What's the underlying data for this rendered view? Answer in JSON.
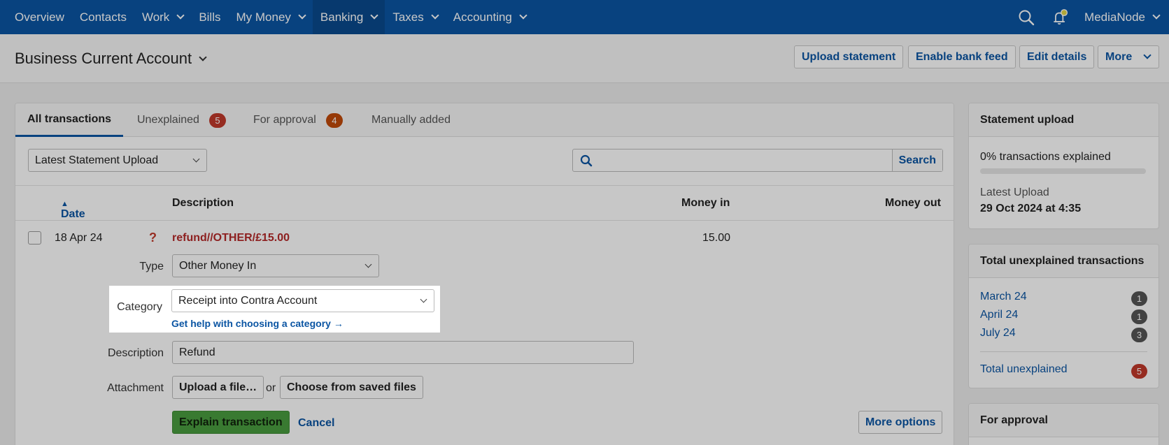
{
  "nav": {
    "items": [
      {
        "label": "Overview",
        "dropdown": false
      },
      {
        "label": "Contacts",
        "dropdown": false
      },
      {
        "label": "Work",
        "dropdown": true
      },
      {
        "label": "Bills",
        "dropdown": false
      },
      {
        "label": "My Money",
        "dropdown": true
      },
      {
        "label": "Banking",
        "dropdown": true,
        "active": true
      },
      {
        "label": "Taxes",
        "dropdown": true
      },
      {
        "label": "Accounting",
        "dropdown": true
      }
    ],
    "org_name": "MediaNode",
    "search_icon": "search-icon",
    "notification_icon": "bell-icon"
  },
  "header": {
    "account_title": "Business Current Account",
    "buttons": {
      "upload_statement": "Upload statement",
      "enable_bank_feed": "Enable bank feed",
      "edit_details": "Edit details",
      "more": "More"
    }
  },
  "tabs": {
    "all": "All transactions",
    "unexplained": "Unexplained",
    "unexplained_count": "5",
    "approval": "For approval",
    "approval_count": "4",
    "manual": "Manually added"
  },
  "toolbar": {
    "filter_value": "Latest Statement Upload",
    "search_placeholder": "",
    "search_button": "Search"
  },
  "table": {
    "headers": {
      "date": "Date",
      "description": "Description",
      "money_in": "Money in",
      "money_out": "Money out"
    },
    "row": {
      "date": "18 Apr 24",
      "status_glyph": "?",
      "description": "refund//OTHER/£15.00",
      "money_in": "15.00",
      "money_out": ""
    }
  },
  "form": {
    "type_label": "Type",
    "type_value": "Other Money In",
    "category_label": "Category",
    "category_value": "Receipt into Contra Account",
    "help_link": "Get help with choosing a category →",
    "description_label": "Description",
    "description_value": "Refund",
    "attachment_label": "Attachment",
    "upload_button": "Upload a file…",
    "or_text": "or",
    "saved_files_button": "Choose from saved files",
    "explain_button": "Explain transaction",
    "cancel_link": "Cancel",
    "more_options_button": "More options"
  },
  "sidebar": {
    "statement_upload": {
      "title": "Statement upload",
      "explained_text": "0% transactions explained",
      "explained_fraction": 0,
      "latest_label": "Latest Upload",
      "latest_value": "29 Oct 2024 at 4:35"
    },
    "unexplained": {
      "title": "Total unexplained transactions",
      "items": [
        {
          "label": "March 24",
          "count": "1"
        },
        {
          "label": "April 24",
          "count": "1"
        },
        {
          "label": "July 24",
          "count": "3"
        }
      ],
      "total_label": "Total unexplained",
      "total_count": "5"
    },
    "approval": {
      "title": "For approval"
    }
  },
  "colors": {
    "nav_bg": "#0b55a3",
    "link": "#0b55a3",
    "danger_badge": "#c0392b",
    "approval_badge": "#c04a0a",
    "explain_button": "#4a9d3f"
  }
}
